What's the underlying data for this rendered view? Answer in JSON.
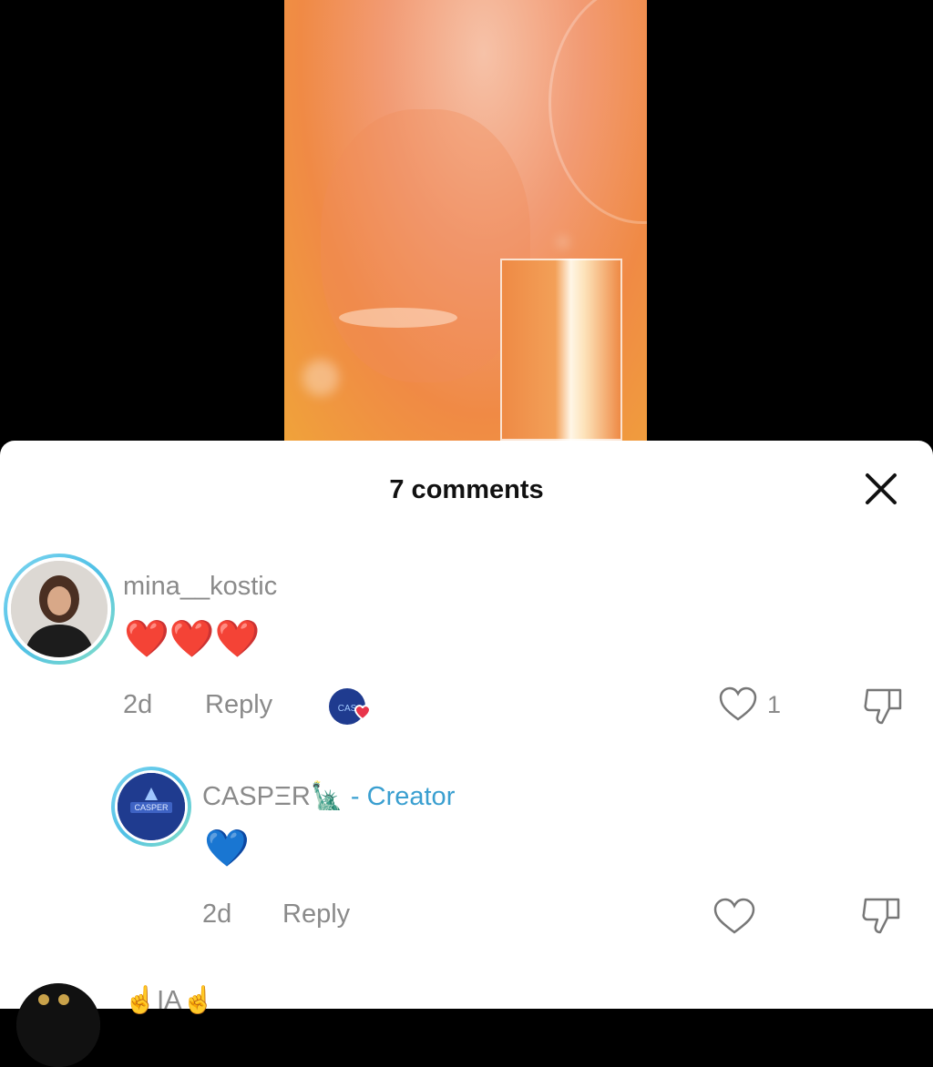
{
  "sheet": {
    "title": "7 comments",
    "close_icon": "close-icon"
  },
  "comments": [
    {
      "username": "mina__kostic",
      "text": "❤️❤️❤️",
      "age": "2d",
      "reply_label": "Reply",
      "likes": "1",
      "liked_by_creator": true
    },
    {
      "username": "CASPΞR🗽",
      "creator_label": " - Creator",
      "text": "💙",
      "age": "2d",
      "reply_label": "Reply"
    },
    {
      "username": "☝️IA☝️"
    }
  ],
  "colors": {
    "creator": "#3a9fd0",
    "heart_red": "#e8344a",
    "ring": "#4fc0e6"
  }
}
